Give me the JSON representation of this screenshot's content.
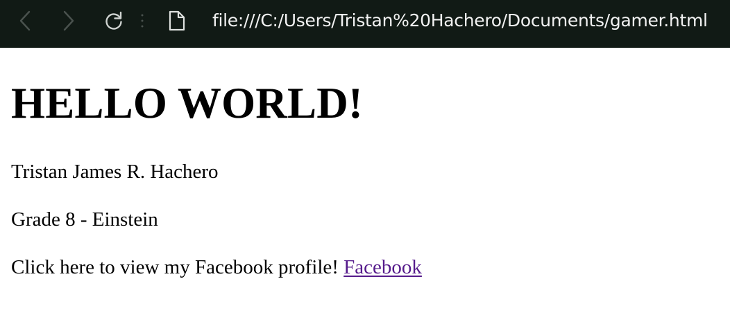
{
  "browser": {
    "url": "file:///C:/Users/Tristan%20Hachero/Documents/gamer.html",
    "icons": {
      "back": "chevron-left-icon",
      "forward": "chevron-right-icon",
      "reload": "reload-icon",
      "menu": "vertical-dots-icon",
      "page": "file-icon"
    }
  },
  "page": {
    "heading": "HELLO WORLD!",
    "name": "Tristan James R. Hachero",
    "grade": "Grade 8 - Einstein",
    "facebook_prompt": "Click here to view my Facebook profile!",
    "facebook_link": "Facebook"
  },
  "colors": {
    "toolbar_bg": "#111a15",
    "visited_link": "#551a8b"
  }
}
